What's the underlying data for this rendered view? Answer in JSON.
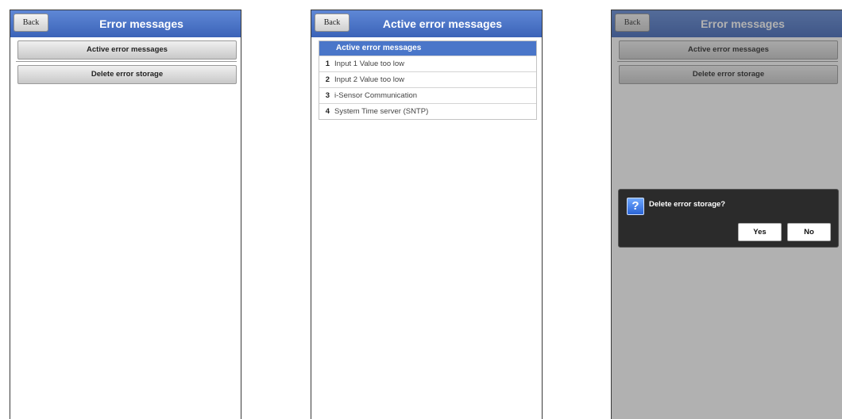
{
  "screens": [
    {
      "back_label": "Back",
      "title": "Error messages",
      "buttons": [
        "Active error messages",
        "Delete error storage"
      ]
    },
    {
      "back_label": "Back",
      "title": "Active error messages",
      "table_header": "Active error messages",
      "rows": [
        {
          "num": "1",
          "text": "Input 1 Value too low"
        },
        {
          "num": "2",
          "text": "Input 2 Value too low"
        },
        {
          "num": "3",
          "text": "i-Sensor Communication"
        },
        {
          "num": "4",
          "text": "System Time server (SNTP)"
        }
      ]
    },
    {
      "back_label": "Back",
      "title": "Error messages",
      "buttons": [
        "Active error messages",
        "Delete error storage"
      ],
      "dialog": {
        "icon": "question-icon",
        "message": "Delete error storage?",
        "yes_label": "Yes",
        "no_label": "No"
      }
    }
  ],
  "colors": {
    "header_blue": "#4a76c9",
    "dialog_bg": "#2b2b2b"
  }
}
